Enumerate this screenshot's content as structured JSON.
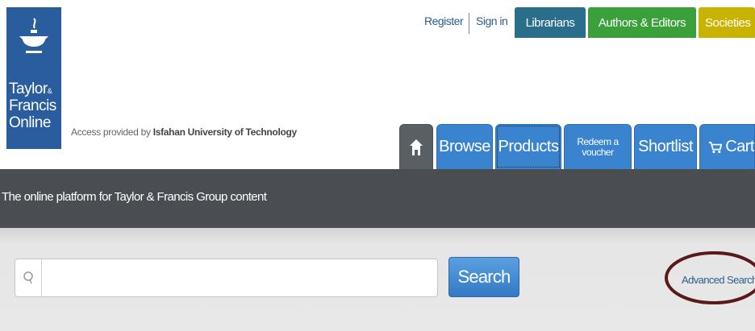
{
  "logo": {
    "line1": "Taylor",
    "amp": "&",
    "line2": "Francis",
    "line3": "Online",
    "color": "#2a5d9e"
  },
  "access": {
    "prefix": "Access provided by",
    "institution": "Isfahan University of Technology"
  },
  "top_links": {
    "register": "Register",
    "sign_in": "Sign in"
  },
  "top_pills": [
    {
      "label": "Librarians",
      "color": "#2a6e8c"
    },
    {
      "label": "Authors & Editors",
      "color": "#3aa03a"
    },
    {
      "label": "Societies",
      "color": "#c8b400"
    }
  ],
  "nav": {
    "home_icon": "home-icon",
    "browse": "Browse",
    "products": "Products",
    "redeem_line1": "Redeem a",
    "redeem_line2": "voucher",
    "shortlist": "Shortlist",
    "cart": "Cart",
    "cart_icon": "cart-icon",
    "tab_color": "#3a84cf"
  },
  "strip": {
    "tagline": "The online platform for Taylor & Francis Group content",
    "color": "#4a4e52"
  },
  "search": {
    "placeholder": "",
    "value": "",
    "button": "Search",
    "advanced": "Advanced Search",
    "search_icon": "search-icon",
    "highlight_color": "#5a1a1a"
  }
}
